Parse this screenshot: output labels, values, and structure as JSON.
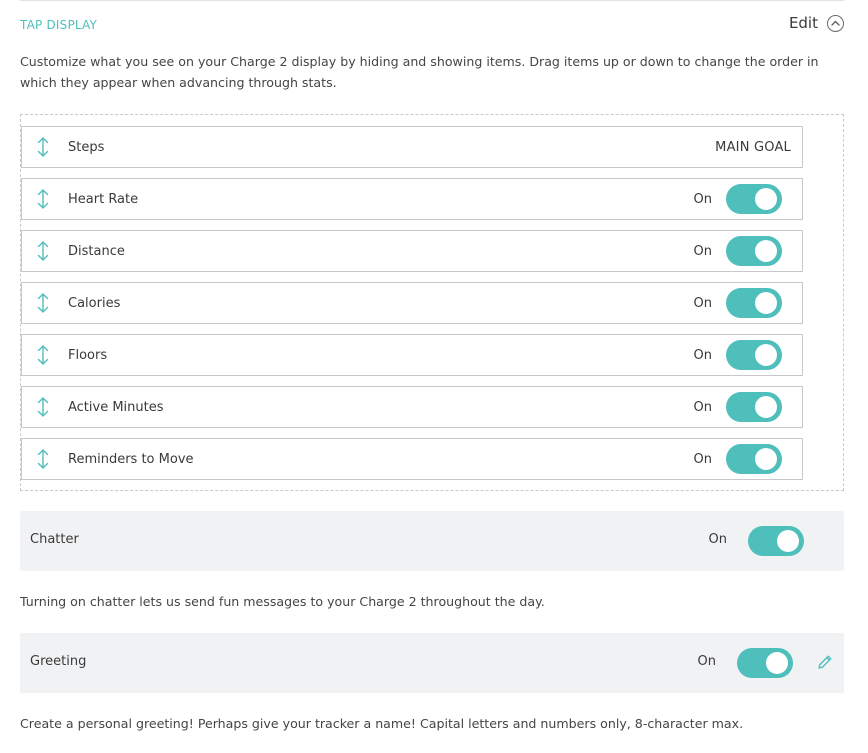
{
  "section": {
    "title": "TAP DISPLAY",
    "edit_label": "Edit",
    "description": "Customize what you see on your Charge 2 display by hiding and showing items. Drag items up or down to change the order in which they appear when advancing through stats."
  },
  "tap_items": [
    {
      "label": "Steps",
      "status": "MAIN GOAL"
    },
    {
      "label": "Heart Rate",
      "status": "On",
      "enabled": true
    },
    {
      "label": "Distance",
      "status": "On",
      "enabled": true
    },
    {
      "label": "Calories",
      "status": "On",
      "enabled": true
    },
    {
      "label": "Floors",
      "status": "On",
      "enabled": true
    },
    {
      "label": "Active Minutes",
      "status": "On",
      "enabled": true
    },
    {
      "label": "Reminders to Move",
      "status": "On",
      "enabled": true
    }
  ],
  "chatter": {
    "label": "Chatter",
    "status": "On",
    "enabled": true,
    "help": "Turning on chatter lets us send fun messages to your Charge 2 throughout the day."
  },
  "greeting": {
    "label": "Greeting",
    "status": "On",
    "enabled": true,
    "help": "Create a personal greeting! Perhaps give your tracker a name! Capital letters and numbers only, 8-character max."
  },
  "icons": {
    "drag": "drag-handle-icon",
    "collapse": "chevron-up-icon",
    "edit": "pencil-icon"
  },
  "colors": {
    "accent": "#4fbfbc",
    "row_background": "#f1f2f4",
    "border": "#c8c8c8"
  }
}
